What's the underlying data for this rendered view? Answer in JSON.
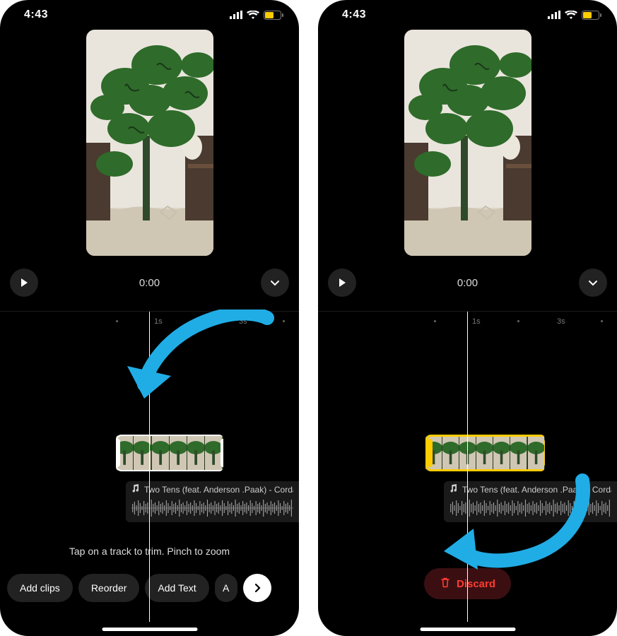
{
  "status": {
    "time": "4:43"
  },
  "preview": {
    "timecode": "0:00"
  },
  "ruler": {
    "marks": [
      "1s",
      "3s"
    ]
  },
  "audio": {
    "title": "Two Tens (feat. Anderson .Paak) - Corda"
  },
  "hint": "Tap on a track to trim. Pinch to zoom",
  "toolbar": {
    "add_clips": "Add clips",
    "reorder": "Reorder",
    "add_text": "Add Text",
    "partial": "A"
  },
  "discard": {
    "label": "Discard"
  },
  "icons": {
    "play": "play-icon",
    "chevron_down": "chevron-down-icon",
    "chevron_right": "chevron-right-icon",
    "music": "music-note-icon",
    "trash": "trash-icon"
  }
}
